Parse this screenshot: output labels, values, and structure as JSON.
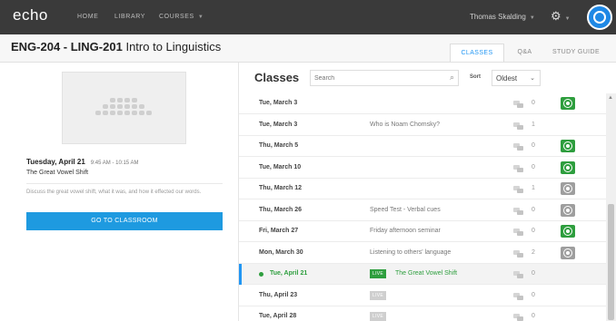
{
  "topbar": {
    "logo": "echo",
    "nav": [
      "HOME",
      "LIBRARY",
      "COURSES"
    ],
    "user": "Thomas Skalding"
  },
  "course": {
    "code": "ENG-204 - LING-201",
    "name": "Intro to Linguistics",
    "tabs": [
      "CLASSES",
      "Q&A",
      "STUDY GUIDE"
    ]
  },
  "detail": {
    "date": "Tuesday, April 21",
    "time": "9:45 AM - 10:15 AM",
    "title": "The Great Vowel Shift",
    "description": "Discuss the great vowel shift, what it was, and how it effected our words.",
    "button": "GO TO CLASSROOM"
  },
  "classes": {
    "heading": "Classes",
    "search_placeholder": "Search",
    "sort_label": "Sort",
    "sort_value": "Oldest",
    "live_label": "LIVE",
    "rows": [
      {
        "date": "Tue, March 3",
        "title": "",
        "count": "0",
        "play": "green",
        "active": false,
        "live": ""
      },
      {
        "date": "Tue, March 3",
        "title": "Who is Noam Chomsky?",
        "count": "1",
        "play": "",
        "active": false,
        "live": ""
      },
      {
        "date": "Thu, March 5",
        "title": "",
        "count": "0",
        "play": "green",
        "active": false,
        "live": ""
      },
      {
        "date": "Tue, March 10",
        "title": "",
        "count": "0",
        "play": "green",
        "active": false,
        "live": ""
      },
      {
        "date": "Thu, March 12",
        "title": "",
        "count": "1",
        "play": "gray",
        "active": false,
        "live": ""
      },
      {
        "date": "Thu, March 26",
        "title": "Speed Test - Verbal cues",
        "count": "0",
        "play": "gray",
        "active": false,
        "live": ""
      },
      {
        "date": "Fri, March 27",
        "title": "Friday afternoon seminar",
        "count": "0",
        "play": "green",
        "active": false,
        "live": ""
      },
      {
        "date": "Mon, March 30",
        "title": "Listening to others' language",
        "count": "2",
        "play": "gray",
        "active": false,
        "live": ""
      },
      {
        "date": "Tue, April 21",
        "title": "The Great Vowel Shift",
        "count": "0",
        "play": "",
        "active": true,
        "live": "on"
      },
      {
        "date": "Thu, April 23",
        "title": "",
        "count": "0",
        "play": "",
        "active": false,
        "live": "off"
      },
      {
        "date": "Tue, April 28",
        "title": "",
        "count": "0",
        "play": "",
        "active": false,
        "live": "off"
      }
    ]
  },
  "colors": {
    "topbar": "#3a3a3a",
    "accent_blue": "#1e9ae0",
    "live_green": "#2e9e3e",
    "muted_gray": "#9e9e9e"
  }
}
